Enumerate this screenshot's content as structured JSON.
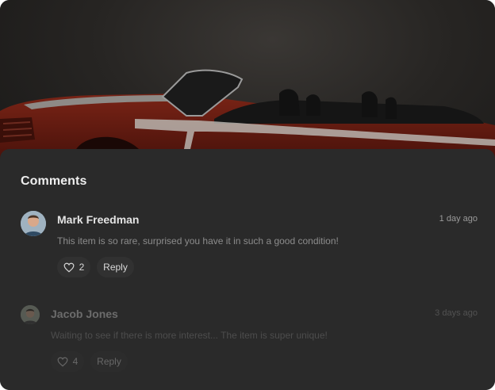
{
  "colors": {
    "sheet_bg": "#2a2a2a",
    "pill_bg": "#313131",
    "car_red": "#6b1d12"
  },
  "header": {
    "title": "Comments"
  },
  "comments": [
    {
      "author": "Mark Freedman",
      "time": "1 day ago",
      "text": "This item is so rare, surprised you have it in such a good condition!",
      "likes": "2",
      "reply_label": "Reply",
      "like_icon": "heart-icon"
    },
    {
      "author": "Jacob Jones",
      "time": "3 days ago",
      "text": "Waiting to see if there is more interest... The item is super unique!",
      "likes": "4",
      "reply_label": "Reply",
      "like_icon": "heart-icon"
    }
  ]
}
